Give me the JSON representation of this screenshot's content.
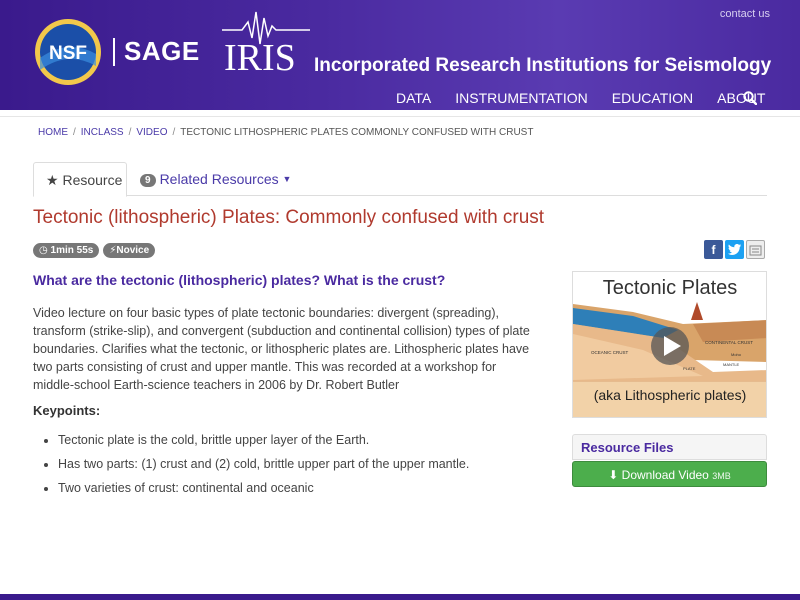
{
  "header": {
    "nsf_label": "NSF",
    "sage_label": "SAGE",
    "iris_label": "IRIS",
    "title": "Incorporated Research Institutions for Seismology",
    "contact": "contact us",
    "nav": [
      "DATA",
      "INSTRUMENTATION",
      "EDUCATION",
      "ABOUT"
    ],
    "brand_color": "#4a2aa0"
  },
  "breadcrumb": {
    "items": [
      "HOME",
      "INCLASS",
      "VIDEO"
    ],
    "current": "TECTONIC LITHOSPHERIC PLATES COMMONLY CONFUSED WITH CRUST"
  },
  "tabs": {
    "resource": "Resource",
    "related_count": "9",
    "related": "Related Resources"
  },
  "page": {
    "title": "Tectonic (lithospheric) Plates: Commonly confused with crust",
    "duration": "1min 55s",
    "level": "Novice",
    "question": "What are the tectonic (lithospheric) plates? What is the crust?",
    "description": "Video lecture on four basic types of plate tectonic boundaries: divergent (spreading), transform (strike-slip), and convergent (subduction and continental collision) types of plate boundaries. Clarifies what the tectonic, or lithospheric plates are. Lithospheric plates have two parts consisting of crust and upper mantle. This was recorded at a workshop for middle-school Earth-science teachers in 2006 by Dr. Robert Butler",
    "keypoints_heading": "Keypoints:",
    "keypoints": [
      "Tectonic plate is the cold, brittle upper layer of the Earth.",
      "Has two parts: (1) crust and (2) cold, brittle upper part of the upper mantle.",
      "Two varieties of crust: continental and oceanic"
    ]
  },
  "thumbnail": {
    "title": "Tectonic Plates",
    "subtitle": "(aka Lithospheric plates)",
    "labels": [
      "OCEANIC CRUST",
      "CONTINENTAL CRUST",
      "Moho",
      "MANTLE",
      "PLATE"
    ]
  },
  "sidebar": {
    "resource_files": "Resource Files",
    "download": "Download Video",
    "download_size": "3MB"
  },
  "share_icons": [
    "facebook-icon",
    "twitter-icon",
    "share-icon"
  ]
}
